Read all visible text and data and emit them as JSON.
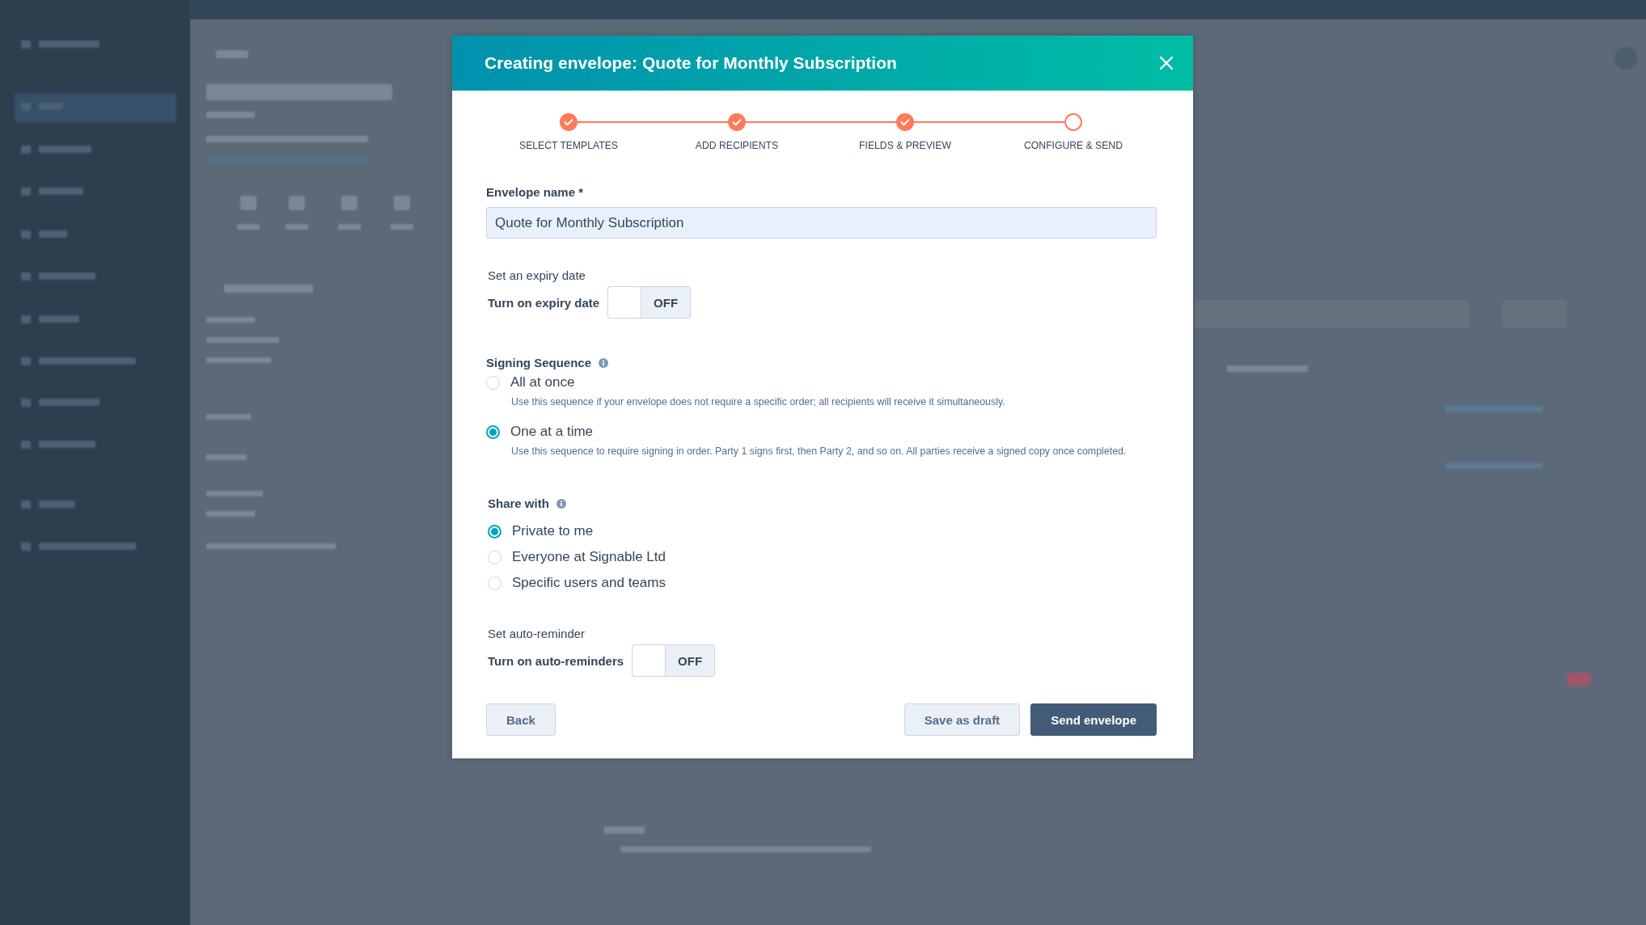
{
  "dialog": {
    "title": "Creating envelope: Quote for Monthly Subscription",
    "steps": [
      {
        "label": "SELECT TEMPLATES",
        "completed": true
      },
      {
        "label": "ADD RECIPIENTS",
        "completed": true
      },
      {
        "label": "FIELDS & PREVIEW",
        "completed": true
      },
      {
        "label": "CONFIGURE & SEND",
        "completed": false
      }
    ],
    "envelope_name": {
      "label": "Envelope name *",
      "value": "Quote for Monthly Subscription"
    },
    "expiry": {
      "heading": "Set an expiry date",
      "label": "Turn on expiry date",
      "on": false,
      "state_text": "OFF"
    },
    "signing_sequence": {
      "heading": "Signing Sequence",
      "options": [
        {
          "label": "All at once",
          "description": "Use this sequence if your envelope does not require a specific order; all recipients will receive it simultaneously.",
          "selected": false
        },
        {
          "label": "One at a time",
          "description": "Use this sequence to require signing in order. Party 1 signs first, then Party 2, and so on. All parties receive a signed copy once completed.",
          "selected": true
        }
      ]
    },
    "share_with": {
      "heading": "Share with",
      "options": [
        {
          "label": "Private to me",
          "selected": true
        },
        {
          "label": "Everyone at Signable Ltd",
          "selected": false
        },
        {
          "label": "Specific users and teams",
          "selected": false
        }
      ]
    },
    "auto_reminder": {
      "heading": "Set auto-reminder",
      "label": "Turn on auto-reminders",
      "on": false,
      "state_text": "OFF"
    },
    "buttons": [
      {
        "label": "Back",
        "kind": "secondary"
      },
      {
        "label": "Save as draft",
        "kind": "secondary"
      },
      {
        "label": "Send envelope",
        "kind": "primary"
      }
    ]
  }
}
